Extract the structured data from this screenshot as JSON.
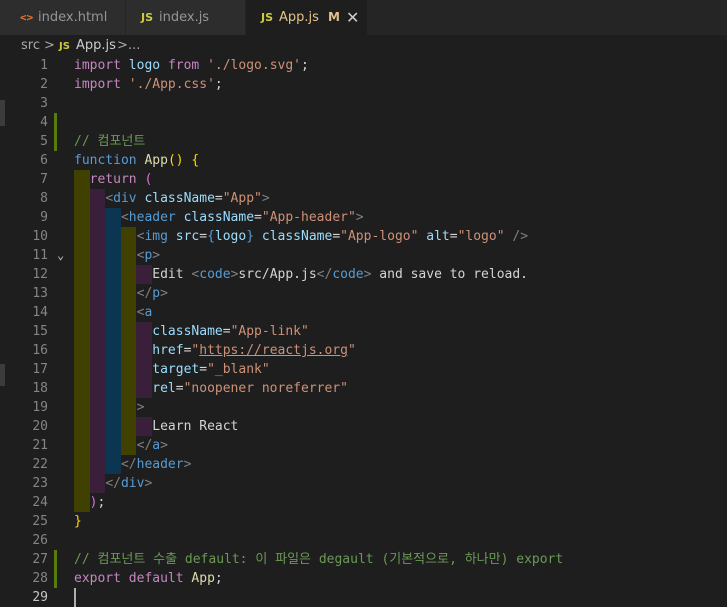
{
  "tabs": [
    {
      "icon": "<>",
      "label": "index.html",
      "active": false
    },
    {
      "icon": "JS",
      "label": "index.js",
      "active": false
    },
    {
      "icon": "JS",
      "label": "App.js",
      "active": true,
      "modified": "M",
      "close": "✕"
    }
  ],
  "breadcrumb": {
    "folder": "src",
    "sep": ">",
    "file_icon": "JS",
    "file": "App.js",
    "more": "..."
  },
  "cursor_line": 29,
  "line_numbers": [
    "1",
    "2",
    "3",
    "4",
    "5",
    "6",
    "7",
    "8",
    "9",
    "10",
    "11",
    "12",
    "13",
    "14",
    "15",
    "16",
    "17",
    "18",
    "19",
    "20",
    "21",
    "22",
    "23",
    "24",
    "25",
    "26",
    "27",
    "28",
    "29"
  ],
  "code_lines": [
    [
      {
        "t": "import",
        "c": "kw"
      },
      {
        "t": " "
      },
      {
        "t": "logo",
        "c": "vr"
      },
      {
        "t": " "
      },
      {
        "t": "from",
        "c": "kw"
      },
      {
        "t": " "
      },
      {
        "t": "'./logo.svg'",
        "c": "st"
      },
      {
        "t": ";",
        "c": "wh"
      }
    ],
    [
      {
        "t": "import",
        "c": "kw"
      },
      {
        "t": " "
      },
      {
        "t": "'./App.css'",
        "c": "st"
      },
      {
        "t": ";",
        "c": "wh"
      }
    ],
    [],
    [],
    [
      {
        "t": "// 컴포넌트",
        "c": "cm"
      }
    ],
    [
      {
        "t": "function",
        "c": "bl"
      },
      {
        "t": " "
      },
      {
        "t": "App",
        "c": "fn"
      },
      {
        "t": "()",
        "c": "yb"
      },
      {
        "t": " "
      },
      {
        "t": "{",
        "c": "yb"
      }
    ],
    [
      {
        "t": "  "
      },
      {
        "t": "return",
        "c": "kw"
      },
      {
        "t": " "
      },
      {
        "t": "(",
        "c": "pb"
      }
    ],
    [
      {
        "t": "    "
      },
      {
        "t": "<",
        "c": "gr"
      },
      {
        "t": "div",
        "c": "tg"
      },
      {
        "t": " "
      },
      {
        "t": "className",
        "c": "at"
      },
      {
        "t": "=",
        "c": "wh"
      },
      {
        "t": "\"App\"",
        "c": "st"
      },
      {
        "t": ">",
        "c": "gr"
      }
    ],
    [
      {
        "t": "      "
      },
      {
        "t": "<",
        "c": "gr"
      },
      {
        "t": "header",
        "c": "tg"
      },
      {
        "t": " "
      },
      {
        "t": "className",
        "c": "at"
      },
      {
        "t": "=",
        "c": "wh"
      },
      {
        "t": "\"App-header\"",
        "c": "st"
      },
      {
        "t": ">",
        "c": "gr"
      }
    ],
    [
      {
        "t": "        "
      },
      {
        "t": "<",
        "c": "gr"
      },
      {
        "t": "img",
        "c": "tg"
      },
      {
        "t": " "
      },
      {
        "t": "src",
        "c": "at"
      },
      {
        "t": "=",
        "c": "wh"
      },
      {
        "t": "{",
        "c": "bl"
      },
      {
        "t": "logo",
        "c": "vr"
      },
      {
        "t": "}",
        "c": "bl"
      },
      {
        "t": " "
      },
      {
        "t": "className",
        "c": "at"
      },
      {
        "t": "=",
        "c": "wh"
      },
      {
        "t": "\"App-logo\"",
        "c": "st"
      },
      {
        "t": " "
      },
      {
        "t": "alt",
        "c": "at"
      },
      {
        "t": "=",
        "c": "wh"
      },
      {
        "t": "\"logo\"",
        "c": "st"
      },
      {
        "t": " "
      },
      {
        "t": "/>",
        "c": "gr"
      }
    ],
    [
      {
        "t": "        "
      },
      {
        "t": "<",
        "c": "gr"
      },
      {
        "t": "p",
        "c": "tg"
      },
      {
        "t": ">",
        "c": "gr"
      }
    ],
    [
      {
        "t": "          "
      },
      {
        "t": "Edit ",
        "c": "wh"
      },
      {
        "t": "<",
        "c": "gr"
      },
      {
        "t": "code",
        "c": "tg"
      },
      {
        "t": ">",
        "c": "gr"
      },
      {
        "t": "src/App.js",
        "c": "wh"
      },
      {
        "t": "</",
        "c": "gr"
      },
      {
        "t": "code",
        "c": "tg"
      },
      {
        "t": ">",
        "c": "gr"
      },
      {
        "t": " and save to reload.",
        "c": "wh"
      }
    ],
    [
      {
        "t": "        "
      },
      {
        "t": "</",
        "c": "gr"
      },
      {
        "t": "p",
        "c": "tg"
      },
      {
        "t": ">",
        "c": "gr"
      }
    ],
    [
      {
        "t": "        "
      },
      {
        "t": "<",
        "c": "gr"
      },
      {
        "t": "a",
        "c": "tg"
      }
    ],
    [
      {
        "t": "          "
      },
      {
        "t": "className",
        "c": "at"
      },
      {
        "t": "=",
        "c": "wh"
      },
      {
        "t": "\"App-link\"",
        "c": "st"
      }
    ],
    [
      {
        "t": "          "
      },
      {
        "t": "href",
        "c": "at"
      },
      {
        "t": "=",
        "c": "wh"
      },
      {
        "t": "\"",
        "c": "st"
      },
      {
        "t": "https://reactjs.org",
        "c": "st ul"
      },
      {
        "t": "\"",
        "c": "st"
      }
    ],
    [
      {
        "t": "          "
      },
      {
        "t": "target",
        "c": "at"
      },
      {
        "t": "=",
        "c": "wh"
      },
      {
        "t": "\"_blank\"",
        "c": "st"
      }
    ],
    [
      {
        "t": "          "
      },
      {
        "t": "rel",
        "c": "at"
      },
      {
        "t": "=",
        "c": "wh"
      },
      {
        "t": "\"noopener noreferrer\"",
        "c": "st"
      }
    ],
    [
      {
        "t": "        "
      },
      {
        "t": ">",
        "c": "gr"
      }
    ],
    [
      {
        "t": "          "
      },
      {
        "t": "Learn React",
        "c": "wh"
      }
    ],
    [
      {
        "t": "        "
      },
      {
        "t": "</",
        "c": "gr"
      },
      {
        "t": "a",
        "c": "tg"
      },
      {
        "t": ">",
        "c": "gr"
      }
    ],
    [
      {
        "t": "      "
      },
      {
        "t": "</",
        "c": "gr"
      },
      {
        "t": "header",
        "c": "tg"
      },
      {
        "t": ">",
        "c": "gr"
      }
    ],
    [
      {
        "t": "    "
      },
      {
        "t": "</",
        "c": "gr"
      },
      {
        "t": "div",
        "c": "tg"
      },
      {
        "t": ">",
        "c": "gr"
      }
    ],
    [
      {
        "t": "  "
      },
      {
        "t": ")",
        "c": "pb"
      },
      {
        "t": ";",
        "c": "wh"
      }
    ],
    [
      {
        "t": "}",
        "c": "yb"
      }
    ],
    [],
    [
      {
        "t": "// 컴포넌트 수출 default: 이 파일은 degault (기본적으로, 하나만) export",
        "c": "cm"
      }
    ],
    [
      {
        "t": "export",
        "c": "kw"
      },
      {
        "t": " "
      },
      {
        "t": "default",
        "c": "kw"
      },
      {
        "t": " "
      },
      {
        "t": "App",
        "c": "fn"
      },
      {
        "t": ";",
        "c": "wh"
      }
    ],
    []
  ],
  "fold_line": 11,
  "fold_icon": "⌄",
  "colors": {
    "editor_bg": "#1e1e1e",
    "tabbar_bg": "#252526",
    "active_tab_text": "#e7c587",
    "keyword": "#c586c0",
    "string": "#ce9178",
    "comment": "#6a9955",
    "tag": "#569cd6",
    "attribute": "#9cdcfe",
    "function": "#dcdcaa",
    "added_gutter": "#587c0c"
  }
}
